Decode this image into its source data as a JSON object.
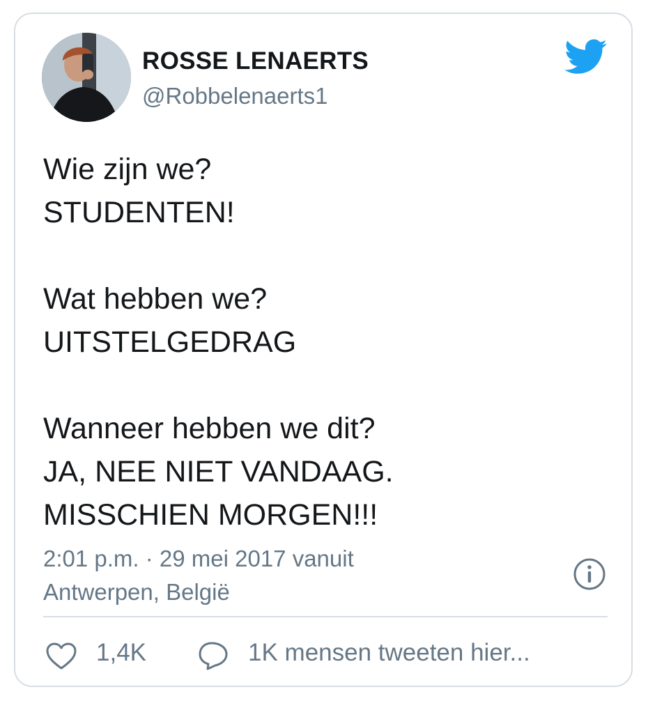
{
  "author": {
    "name": "ROSSE LENAERTS",
    "handle": "@Robbelenaerts1"
  },
  "icons": {
    "bird": "twitter-bird-icon",
    "info": "info-icon",
    "like": "heart-icon",
    "reply": "speech-bubble-icon"
  },
  "tweet": {
    "line1": "Wie zijn we?",
    "line2": "STUDENTEN!",
    "line3": "Wat hebben we?",
    "line4": "UITSTELGEDRAG",
    "line5": "Wanneer hebben we dit?",
    "line6": "JA, NEE NIET VANDAAG.",
    "line7": "MISSCHIEN MORGEN!!!"
  },
  "meta": {
    "line1": "2:01 p.m. · 29 mei 2017 vanuit",
    "line2": "Antwerpen, België"
  },
  "actions": {
    "like_count": "1,4K",
    "reply_text": "1K mensen tweeten hier..."
  },
  "colors": {
    "twitter_blue": "#1da1f2",
    "secondary_text": "#657786",
    "border": "#d7dde3"
  }
}
